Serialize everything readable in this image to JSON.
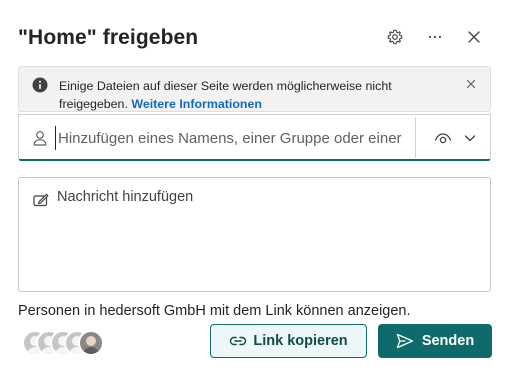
{
  "dialog": {
    "title": "\"Home\" freigeben",
    "header_icons": [
      "gear-icon",
      "more-horizontal-icon",
      "close-icon"
    ]
  },
  "banner": {
    "message": "Einige Dateien auf dieser Seite werden möglicherweise nicht freigegeben.",
    "link_label": "Weitere Informationen",
    "icon": "info-icon"
  },
  "people_input": {
    "placeholder": "Hinzufügen eines Namens, einer Gruppe oder einer",
    "value": "",
    "permission_icon": "eye-icon"
  },
  "message_input": {
    "placeholder": "Nachricht hinzufügen",
    "value": ""
  },
  "link_info": "Personen in hedersoft GmbH mit dem Link können anzeigen.",
  "buttons": {
    "copy_link": "Link kopieren",
    "send": "Senden"
  },
  "colors": {
    "accent": "#0f6b6b",
    "link": "#0f6cbd",
    "banner_bg": "#f3f2f1"
  }
}
